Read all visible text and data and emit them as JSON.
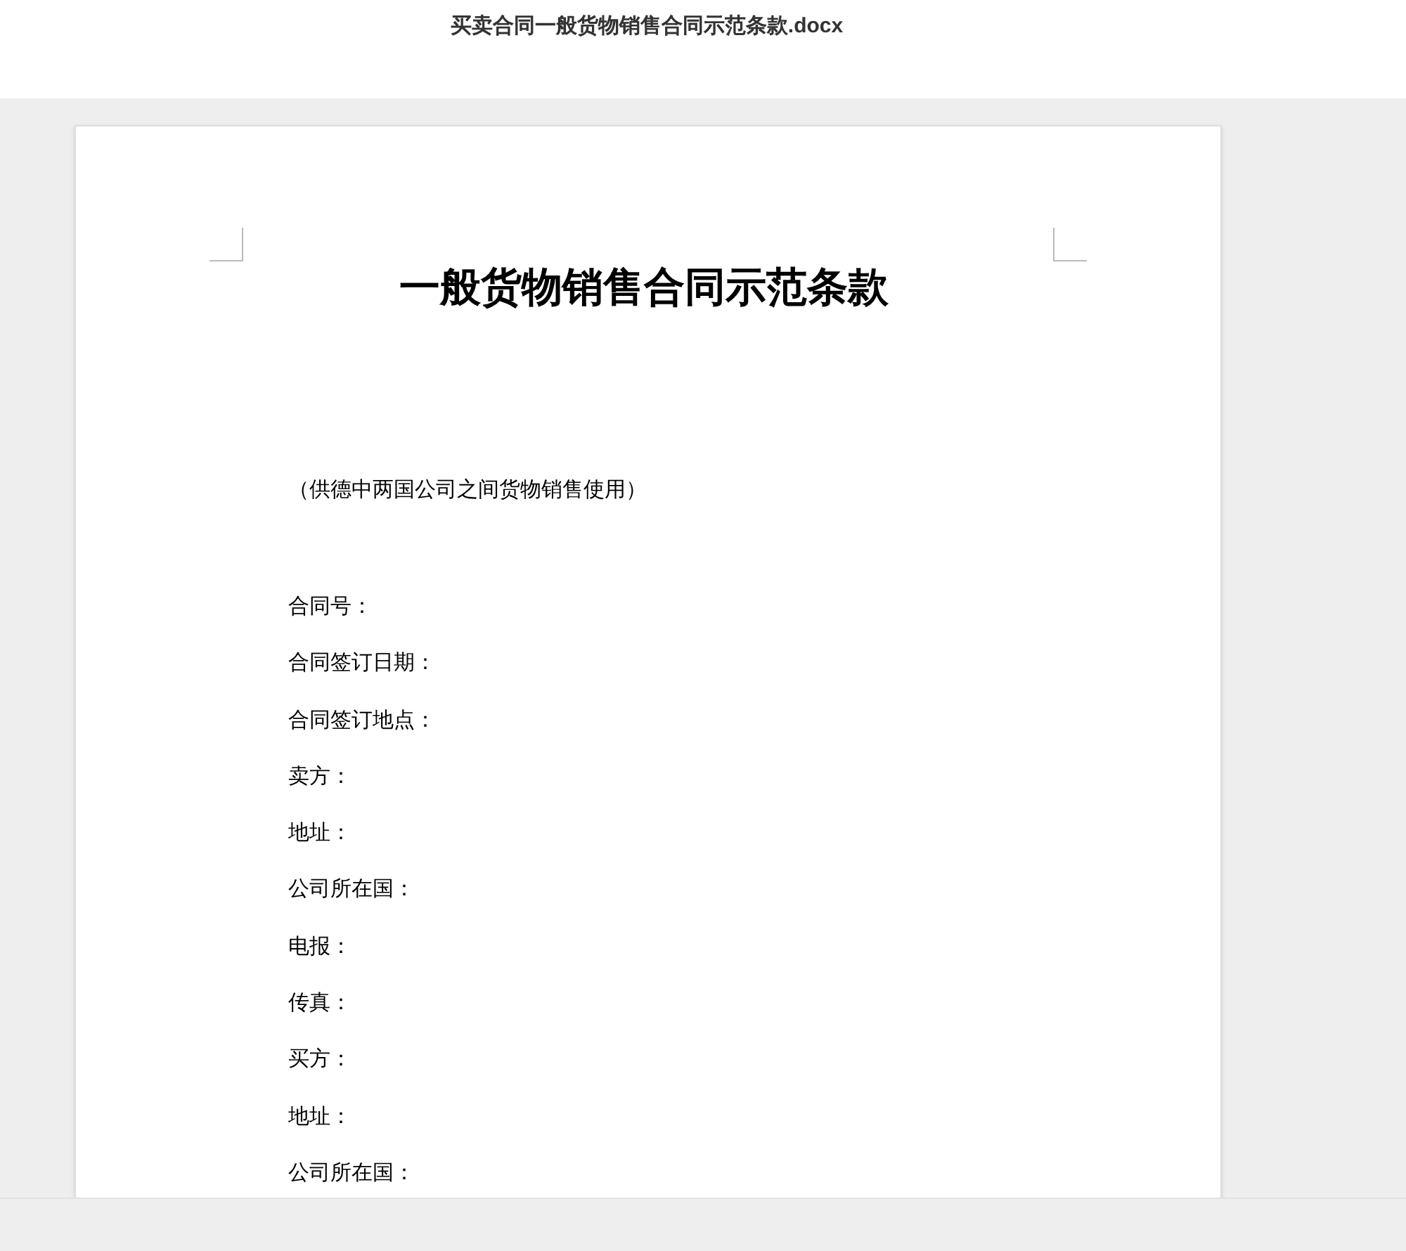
{
  "window": {
    "title": "买卖合同一般货物销售合同示范条款.docx"
  },
  "document": {
    "heading": "一般货物销售合同示范条款",
    "subtitle": "（供德中两国公司之间货物销售使用）",
    "fields": [
      "合同号：",
      "合同签订日期：",
      "合同签订地点：",
      "卖方：",
      "地址：",
      "公司所在国：",
      "电报：",
      "传真：",
      "买方：",
      "地址：",
      "公司所在国："
    ]
  }
}
